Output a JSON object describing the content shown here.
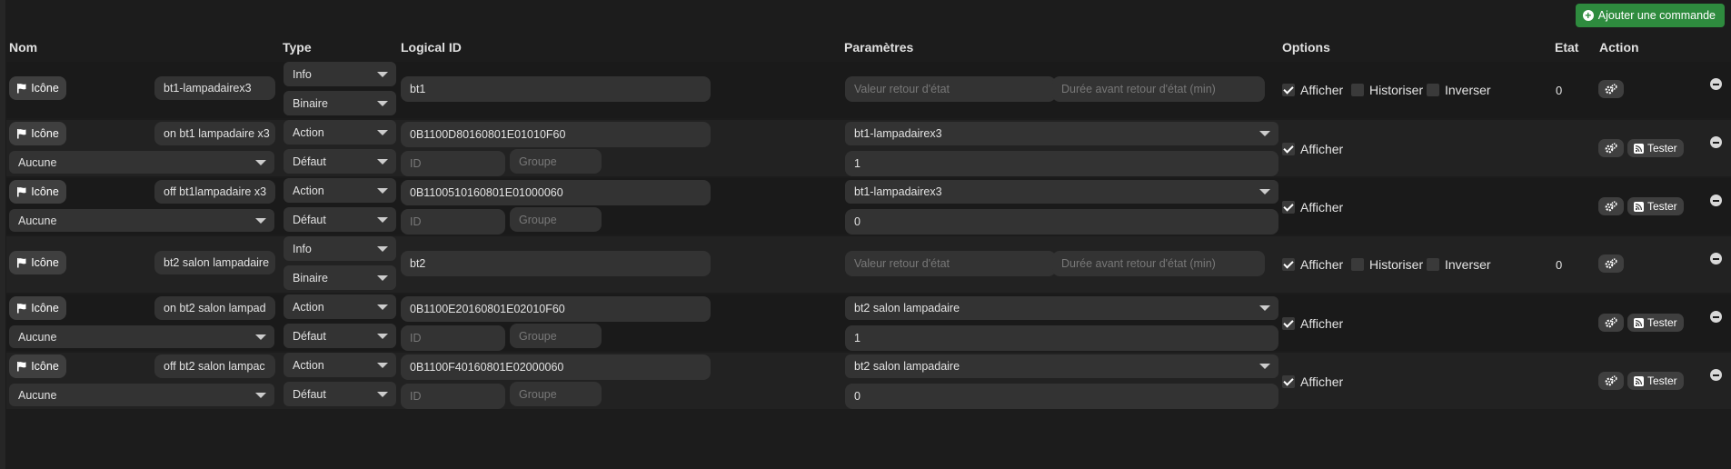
{
  "add_button_label": "Ajouter une commande",
  "headers": {
    "nom": "Nom",
    "type": "Type",
    "logical_id": "Logical ID",
    "parametres": "Paramètres",
    "options": "Options",
    "etat": "Etat",
    "action": "Action"
  },
  "labels": {
    "icon_button": "Icône",
    "afficher": "Afficher",
    "historiser": "Historiser",
    "inverser": "Inverser",
    "tester": "Tester",
    "id_placeholder": "ID",
    "groupe_placeholder": "Groupe",
    "valeur_retour_placeholder": "Valeur retour d'état",
    "duree_retour_placeholder": "Durée avant retour d'état (min)"
  },
  "commands": [
    {
      "kind": "info",
      "name": "bt1-lampadairex3",
      "type": "Info",
      "subtype": "Binaire",
      "logical_id": "bt1",
      "afficher": true,
      "historiser": false,
      "inverser": false,
      "etat": "0"
    },
    {
      "kind": "action",
      "name": "on bt1 lampadaire x3",
      "type": "Action",
      "subtype": "Défaut",
      "sub_select": "Aucune",
      "logical_id": "0B1100D80160801E01010F60",
      "param_select": "bt1-lampadairex3",
      "param_value": "1",
      "afficher": true
    },
    {
      "kind": "action",
      "name": "off bt1lampadaire x3",
      "type": "Action",
      "subtype": "Défaut",
      "sub_select": "Aucune",
      "logical_id": "0B1100510160801E01000060",
      "param_select": "bt1-lampadairex3",
      "param_value": "0",
      "afficher": true
    },
    {
      "kind": "info",
      "name": "bt2 salon lampadaire",
      "type": "Info",
      "subtype": "Binaire",
      "logical_id": "bt2",
      "afficher": true,
      "historiser": false,
      "inverser": false,
      "etat": "0"
    },
    {
      "kind": "action",
      "name": "on bt2 salon  lampad",
      "type": "Action",
      "subtype": "Défaut",
      "sub_select": "Aucune",
      "logical_id": "0B1100E20160801E02010F60",
      "param_select": "bt2 salon lampadaire",
      "param_value": "1",
      "afficher": true
    },
    {
      "kind": "action",
      "name": "off bt2  salon lampac",
      "type": "Action",
      "subtype": "Défaut",
      "sub_select": "Aucune",
      "logical_id": "0B1100F40160801E02000060",
      "param_select": "bt2 salon lampadaire",
      "param_value": "0",
      "afficher": true
    }
  ]
}
